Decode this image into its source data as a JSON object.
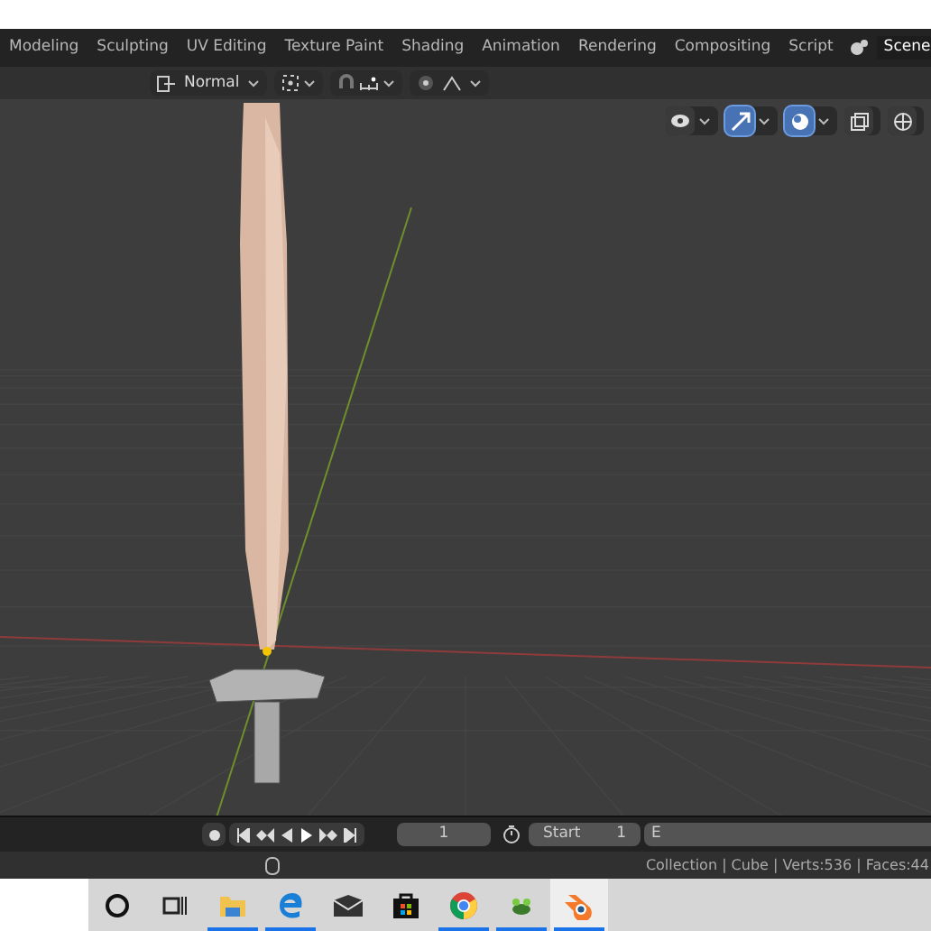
{
  "workspace_tabs": [
    {
      "label": "Modeling",
      "selected": false
    },
    {
      "label": "Sculpting",
      "selected": false
    },
    {
      "label": "UV Editing",
      "selected": false
    },
    {
      "label": "Texture Paint",
      "selected": false
    },
    {
      "label": "Shading",
      "selected": false
    },
    {
      "label": "Animation",
      "selected": false
    },
    {
      "label": "Rendering",
      "selected": false
    },
    {
      "label": "Compositing",
      "selected": false
    },
    {
      "label": "Script",
      "selected": false
    }
  ],
  "scene": {
    "label": "Scene"
  },
  "header": {
    "mode": "Normal"
  },
  "viewport_toggles": [
    {
      "kind": "visibility",
      "on": false
    },
    {
      "kind": "gizmo",
      "on": true
    },
    {
      "kind": "overlay",
      "on": true
    },
    {
      "kind": "xray",
      "on": false
    },
    {
      "kind": "shading",
      "on": false
    }
  ],
  "timeline": {
    "frame": "1",
    "start_label": "Start",
    "start_value": "1",
    "end_label": "E"
  },
  "status_bar": {
    "text": "Collection | Cube | Verts:536 | Faces:44"
  },
  "taskbar": [
    {
      "kind": "cortana",
      "running": false,
      "selected": false
    },
    {
      "kind": "taskview",
      "running": false,
      "selected": false
    },
    {
      "kind": "folder",
      "running": true,
      "selected": false
    },
    {
      "kind": "edge",
      "running": true,
      "selected": false
    },
    {
      "kind": "mail",
      "running": false,
      "selected": false
    },
    {
      "kind": "store",
      "running": false,
      "selected": false
    },
    {
      "kind": "chrome",
      "running": true,
      "selected": false
    },
    {
      "kind": "plant",
      "running": true,
      "selected": false
    },
    {
      "kind": "blender",
      "running": true,
      "selected": true
    }
  ]
}
